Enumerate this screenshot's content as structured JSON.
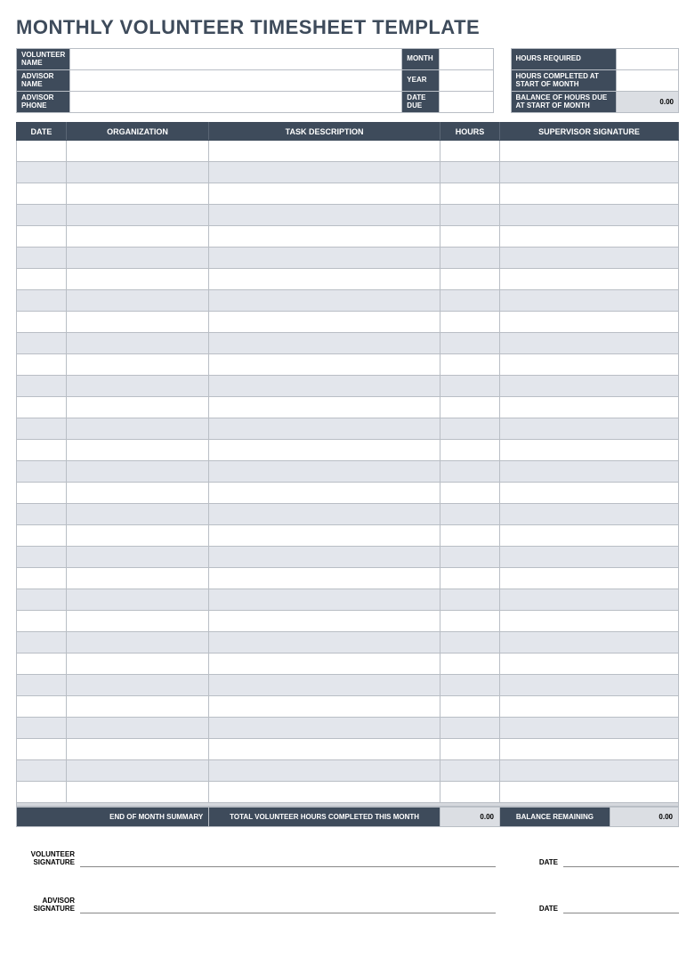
{
  "title": "MONTHLY VOLUNTEER TIMESHEET TEMPLATE",
  "header": {
    "volunteer_name_label": "VOLUNTEER NAME",
    "volunteer_name_value": "",
    "advisor_name_label": "ADVISOR NAME",
    "advisor_name_value": "",
    "advisor_phone_label": "ADVISOR PHONE",
    "advisor_phone_value": "",
    "month_label": "MONTH",
    "month_value": "",
    "year_label": "YEAR",
    "year_value": "",
    "date_due_label": "DATE DUE",
    "date_due_value": "",
    "hours_required_label": "HOURS REQUIRED",
    "hours_required_value": "",
    "hours_completed_label": "HOURS COMPLETED AT START OF MONTH",
    "hours_completed_value": "",
    "balance_due_label": "BALANCE OF HOURS DUE AT START OF MONTH",
    "balance_due_value": "0.00"
  },
  "columns": {
    "date": "DATE",
    "organization": "ORGANIZATION",
    "task": "TASK DESCRIPTION",
    "hours": "HOURS",
    "signature": "SUPERVISOR SIGNATURE"
  },
  "rows_count": 31,
  "summary": {
    "end_label": "END OF MONTH SUMMARY",
    "total_label": "TOTAL VOLUNTEER HOURS COMPLETED THIS MONTH",
    "total_value": "0.00",
    "balance_label": "BALANCE REMAINING",
    "balance_value": "0.00"
  },
  "signatures": {
    "volunteer_label": "VOLUNTEER SIGNATURE",
    "advisor_label": "ADVISOR SIGNATURE",
    "date_label": "DATE"
  }
}
